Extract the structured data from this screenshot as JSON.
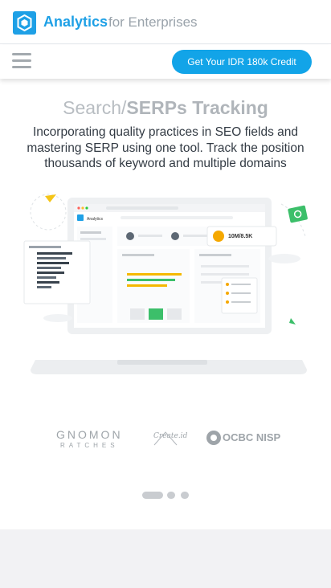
{
  "brand": {
    "name": "Analytics",
    "tagline": "for Enterprises",
    "accent": "#1ea0e6"
  },
  "nav": {
    "menu_icon": "hamburger-icon",
    "cta_label": "Get Your IDR 180k Credit",
    "cta_color": "#12a4e8"
  },
  "hero": {
    "title_light": "Search/",
    "title_bold": "SERPs Tracking",
    "description": "Incorporating quality practices in SEO fields and mastering SERP using one tool. Track the position thousands of keyword and multiple domains"
  },
  "illustration": {
    "stat_value": "10M/8.5K",
    "screen_title": "Analytics"
  },
  "clients": {
    "gnomon_line1": "GNOMON",
    "gnomon_line2": "RATCHES",
    "createid": "Create.id",
    "ocbc": "OCBC NISP"
  },
  "carousel": {
    "active_index": 0,
    "total": 3
  }
}
